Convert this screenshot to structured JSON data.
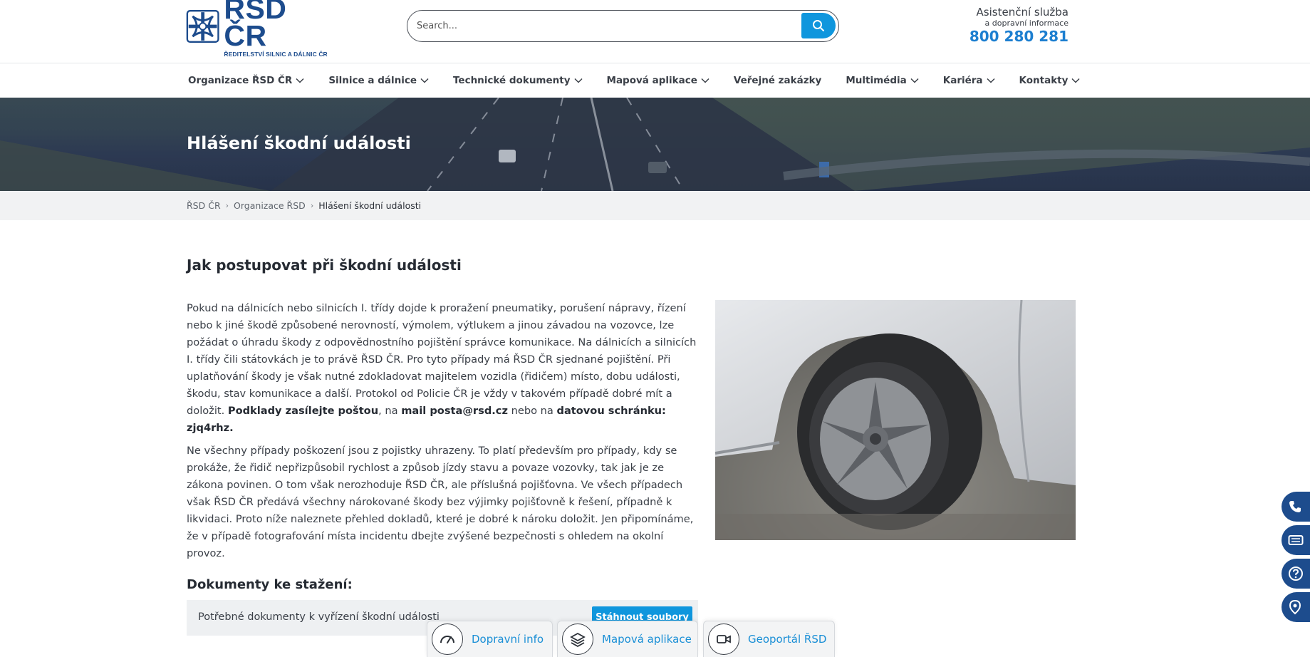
{
  "header": {
    "logo_title": "ŘSD ČR",
    "logo_subtitle": "ŘEDITELSTVÍ SILNIC A DÁLNIC ČR",
    "search_placeholder": "Search...",
    "assist_title": "Asistenční služba",
    "assist_subtitle": "a dopravní informace",
    "assist_phone": "800 280 281"
  },
  "nav": {
    "items": [
      {
        "label": "Organizace ŘSD ČR",
        "dropdown": true
      },
      {
        "label": "Silnice a dálnice",
        "dropdown": true
      },
      {
        "label": "Technické dokumenty",
        "dropdown": true
      },
      {
        "label": "Mapová aplikace",
        "dropdown": true
      },
      {
        "label": "Veřejné zakázky",
        "dropdown": false
      },
      {
        "label": "Multimédia",
        "dropdown": true
      },
      {
        "label": "Kariéra",
        "dropdown": true
      },
      {
        "label": "Kontakty",
        "dropdown": true
      }
    ]
  },
  "hero": {
    "title": "Hlášení škodní události"
  },
  "breadcrumb": {
    "items": [
      "ŘSD ČR",
      "Organizace ŘSD",
      "Hlášení škodní události"
    ]
  },
  "content": {
    "heading": "Jak postupovat při škodní události",
    "p1_text": "Pokud na dálnicích nebo silnicích I. třídy dojde k proražení pneumatiky, porušení nápravy, řízení nebo k jiné škodě způsobené nerovností, výmolem, výtlukem a jinou závadou na vozovce, lze požádat o úhradu škody z odpovědnostního pojištění správce komunikace. Na dálnicích a silnicích I. třídy čili státovkách je to právě ŘSD ČR. Pro tyto případy má ŘSD ČR sjednané pojištění. Při uplatňování škody je však nutné zdokladovat majitelem vozidla (řidičem) místo, dobu události, škodu, stav komunikace a další. Protokol od Policie ČR je vždy v takovém případě dobré mít a doložit. ",
    "p1_bold1": "Podklady zasílejte poštou",
    "p1_mid1": ", na ",
    "p1_bold2": "mail posta@rsd.cz",
    "p1_mid2": " nebo na ",
    "p1_bold3": "datovou schránku: zjq4rhz.",
    "p2_text": "Ne všechny případy poškození jsou z pojistky uhrazeny. To platí především pro případy, kdy se prokáže, že řidič nepřizpůsobil rychlost a způsob jízdy stavu a povaze vozovky, tak jak je ze zákona povinen. O tom však nerozhoduje ŘSD ČR, ale příslušná pojišťovna. Ve všech případech však ŘSD ČR předává všechny nárokované škody bez výjimky pojišťovně k řešení, případně k likvidaci. Proto níže naleznete přehled dokladů, které je dobré k nároku doložit. Jen připomínáme, že v případě fotografování místa incidentu dbejte zvýšené bezpečnosti s ohledem na okolní provoz.",
    "docs_heading": "Dokumenty ke stažení:",
    "docs_label": "Potřebné dokumenty k vyřízení škodní události",
    "docs_button": "Stáhnout soubory"
  },
  "quick_tabs": [
    {
      "label": "Dopravní info",
      "icon": "speedometer-icon"
    },
    {
      "label": "Mapová aplikace",
      "icon": "layers-icon"
    },
    {
      "label": "Geoportál ŘSD",
      "icon": "video-camera-icon"
    }
  ],
  "float_buttons": [
    "phone-icon",
    "ticket-icon",
    "help-icon",
    "location-icon"
  ],
  "colors": {
    "brand_blue": "#1d4c8d",
    "accent_blue": "#0f96dd",
    "link_blue": "#1a8fd6",
    "text_dark": "#3a3f47"
  }
}
